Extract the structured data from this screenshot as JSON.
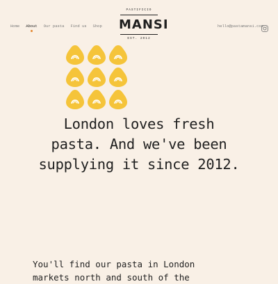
{
  "nav": {
    "items": [
      {
        "label": "Home",
        "active": false
      },
      {
        "label": "About",
        "active": true
      },
      {
        "label": "Our pasta",
        "active": false
      },
      {
        "label": "Find us",
        "active": false
      },
      {
        "label": "Shop",
        "active": false
      }
    ],
    "active_color": "#e3852c"
  },
  "logo": {
    "top_text": "PASTIFICIO",
    "name": "MANSI",
    "bottom_text": "EST. 2012"
  },
  "contact": {
    "email": "hello@pastamansi.com",
    "social_icon": "instagram-icon"
  },
  "pasta_icons": {
    "count": 9,
    "color": "#f5c43a"
  },
  "headline": {
    "line1": "London loves fresh",
    "line2": "pasta. And we've been",
    "line3": "supplying it since 2012."
  },
  "body": {
    "line1": "You'll find our pasta in London",
    "line2": "markets north and south of the"
  },
  "colors": {
    "background": "#f9f0e6",
    "text": "#1f1f1f"
  }
}
